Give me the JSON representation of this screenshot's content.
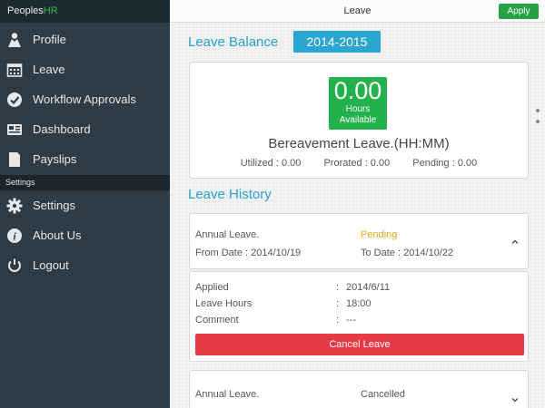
{
  "brand": {
    "part1": "Peoples",
    "part2": "HR"
  },
  "sidebar": {
    "items": [
      {
        "label": "Profile",
        "icon": "profile-icon"
      },
      {
        "label": "Leave",
        "icon": "calendar-icon"
      },
      {
        "label": "Workflow Approvals",
        "icon": "check-circle-icon"
      },
      {
        "label": "Dashboard",
        "icon": "dashboard-icon"
      },
      {
        "label": "Payslips",
        "icon": "document-icon"
      }
    ],
    "settings_header": "Settings",
    "settings_items": [
      {
        "label": "Settings",
        "icon": "gear-icon"
      },
      {
        "label": "About Us",
        "icon": "info-icon"
      },
      {
        "label": "Logout",
        "icon": "power-icon"
      }
    ]
  },
  "header": {
    "title": "Leave",
    "apply_label": "Apply"
  },
  "balance": {
    "title": "Leave Balance",
    "year": "2014-2015",
    "hours_value": "0.00",
    "hours_label_1": "Hours",
    "hours_label_2": "Available",
    "leave_type": "Bereavement Leave.(HH:MM)",
    "utilized": "Utilized : 0.00",
    "prorated": "Prorated : 0.00",
    "pending": "Pending : 0.00"
  },
  "history": {
    "title": "Leave History",
    "items": [
      {
        "type": "Annual Leave.",
        "status": "Pending",
        "from": "From Date : 2014/10/19",
        "to": "To Date : 2014/10/22"
      },
      {
        "type": "Annual Leave.",
        "status": "Cancelled"
      }
    ],
    "details": {
      "applied_label": "Applied",
      "applied_value": "2014/6/11",
      "hours_label": "Leave Hours",
      "hours_value": "18:00",
      "comment_label": "Comment",
      "comment_value": "---",
      "separator": ":",
      "cancel_label": "Cancel Leave"
    }
  },
  "colors": {
    "sidebar": "#2f3b45",
    "accent_blue": "#2a9fd0",
    "green": "#22b14c",
    "pending": "#f0a81a",
    "cancel_red": "#e63b47"
  }
}
